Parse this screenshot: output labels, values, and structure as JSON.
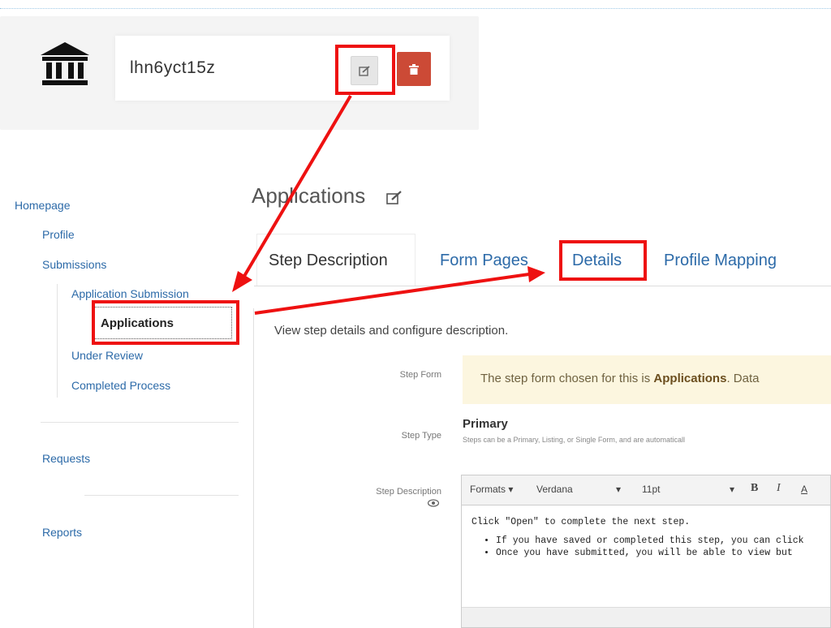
{
  "header": {
    "app_name": "lhn6yct15z",
    "bank_icon": "bank-building-icon",
    "edit_icon": "edit-icon",
    "delete_icon": "trash-icon"
  },
  "sidebar": {
    "homepage": "Homepage",
    "profile": "Profile",
    "submissions": "Submissions",
    "application_submission": "Application Submission",
    "applications": "Applications",
    "under_review": "Under Review",
    "completed_process": "Completed Process",
    "requests": "Requests",
    "reports": "Reports"
  },
  "main": {
    "title": "Applications",
    "tabs": [
      "Step Description",
      "Form Pages",
      "Details",
      "Profile Mapping"
    ],
    "description": "View step details and configure description.",
    "step_form_label": "Step Form",
    "step_form_alert_prefix": "The step form chosen for this is ",
    "step_form_alert_bold": "Applications",
    "step_form_alert_suffix": ". Data",
    "step_type_label": "Step Type",
    "step_type_value": "Primary",
    "step_type_help": "Steps can be a Primary, Listing, or Single Form, and are automaticall",
    "step_description_label": "Step Description",
    "eye_icon": "eye-icon"
  },
  "editor": {
    "formats": "Formats",
    "font": "Verdana",
    "size": "11pt",
    "bold": "B",
    "italic": "I",
    "font_color": "A",
    "line1": "Click \"Open\" to complete the next step.",
    "bullets": [
      "If you have saved or completed this step, you can click",
      "Once you have submitted, you will be able to view but"
    ]
  },
  "colors": {
    "link": "#2c6aa8",
    "highlight": "#ee1111",
    "delete": "#cc4a36",
    "alert_bg": "#fcf6df"
  }
}
